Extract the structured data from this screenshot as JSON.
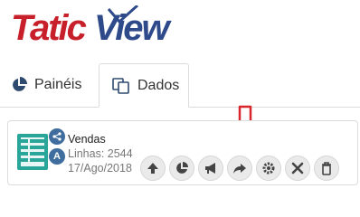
{
  "brand": {
    "logo_text": "TaticView",
    "colors": {
      "red": "#c8202a",
      "blue": "#2e4a8a"
    }
  },
  "tabs": [
    {
      "label": "Painéis",
      "icon": "pie-chart-icon",
      "active": false
    },
    {
      "label": "Dados",
      "icon": "copy-icon",
      "active": true
    }
  ],
  "dataset": {
    "name": "Vendas",
    "rows_label": "Linhas: 2544",
    "date": "17/Ago/2018",
    "badges": [
      "share-icon",
      "A"
    ]
  },
  "actions": [
    "upload-icon",
    "pie-chart-icon",
    "megaphone-icon",
    "share-arrow-icon",
    "gear-icon",
    "close-icon",
    "trash-icon"
  ],
  "hint_color": "#d9262c"
}
